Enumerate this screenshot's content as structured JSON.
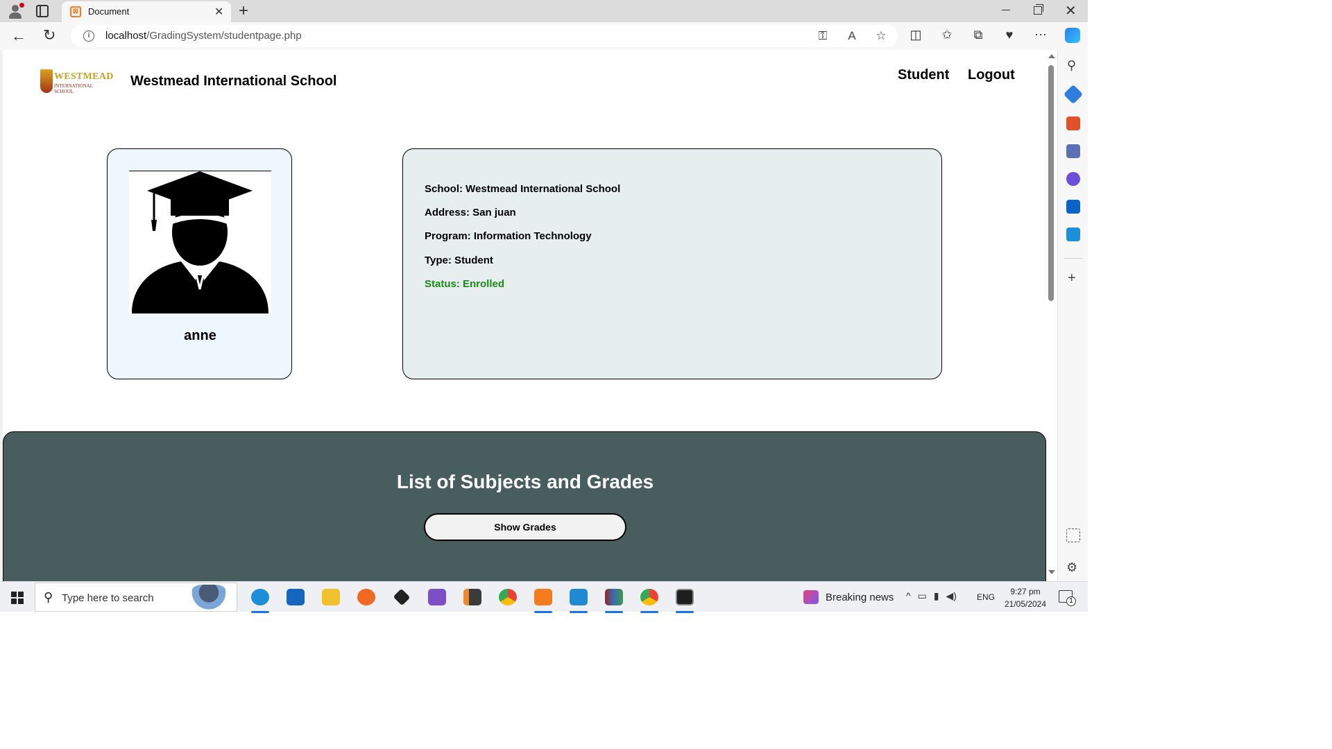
{
  "browser": {
    "tab_title": "Document",
    "tab_close": "✕",
    "new_tab": "+",
    "url_host": "localhost",
    "url_path": "/GradingSystem/studentpage.php",
    "window_close": "✕"
  },
  "header": {
    "logo_text": "WESTMEAD",
    "logo_subtext": "INTERNATIONAL SCHOOL",
    "site_title": "Westmead International School",
    "nav": {
      "student": "Student",
      "logout": "Logout"
    }
  },
  "profile": {
    "name": "anne"
  },
  "info": {
    "school": "School: Westmead International School",
    "address": "Address: San juan",
    "program": "Program: Information Technology",
    "type": "Type: Student",
    "status": "Status: Enrolled",
    "status_color": "#1b8a1b"
  },
  "grades": {
    "title": "List of Subjects and Grades",
    "button_label": "Show Grades",
    "section_color": "#475d5e"
  },
  "taskbar": {
    "search_placeholder": "Type here to search",
    "news": "Breaking news",
    "language": "ENG",
    "time": "9:27 pm",
    "date": "21/05/2024",
    "notification_count": "1",
    "apps": [
      "edge-icon",
      "mail-icon",
      "file-explorer-icon",
      "firefox-icon",
      "dropbox-icon",
      "visual-studio-icon",
      "sublime-text-icon",
      "chrome-icon",
      "xampp-icon",
      "vscode-icon",
      "winrar-icon",
      "chrome-profile-icon",
      "terminal-icon"
    ]
  }
}
